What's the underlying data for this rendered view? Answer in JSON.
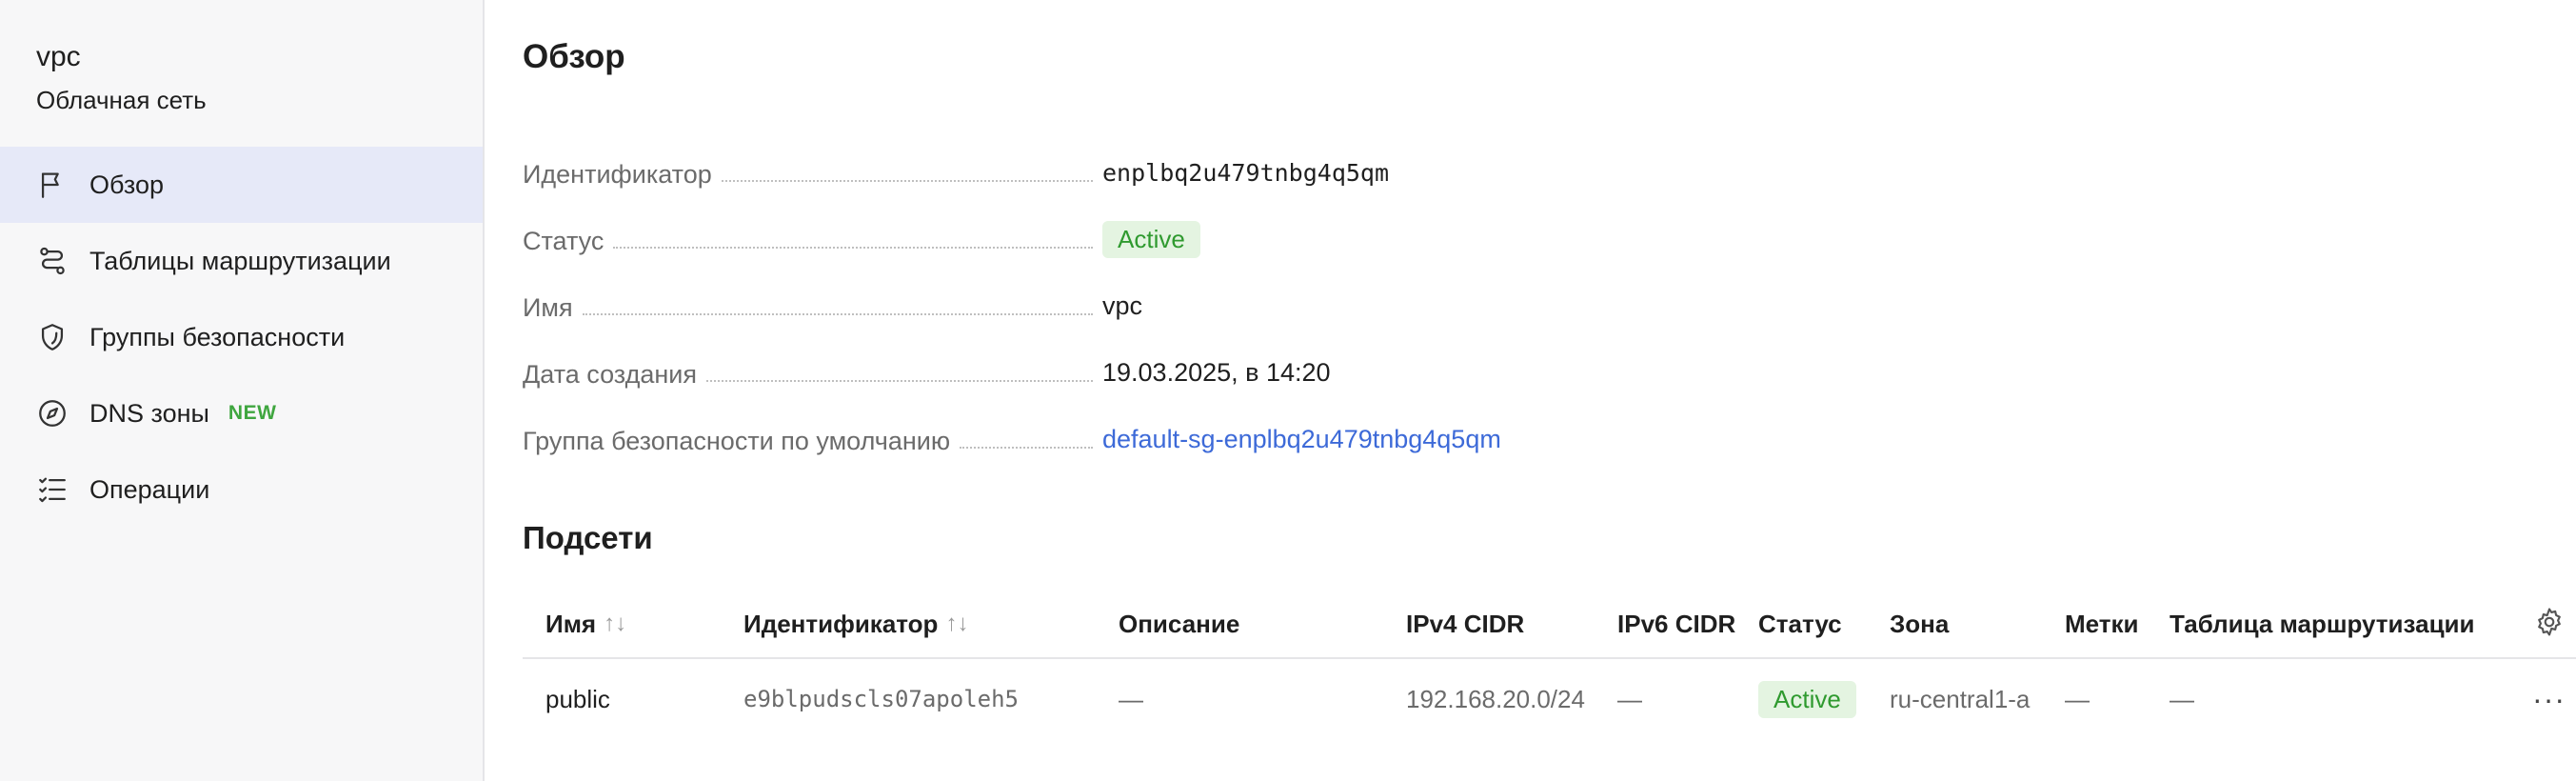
{
  "sidebar": {
    "service_name": "vpc",
    "service_subtitle": "Облачная сеть",
    "items": [
      {
        "label": "Обзор",
        "icon": "flag-icon",
        "active": true
      },
      {
        "label": "Таблицы маршрутизации",
        "icon": "route-icon",
        "active": false
      },
      {
        "label": "Группы безопасности",
        "icon": "shield-icon",
        "active": false
      },
      {
        "label": "DNS зоны",
        "icon": "compass-icon",
        "active": false,
        "badge": "NEW"
      },
      {
        "label": "Операции",
        "icon": "list-check-icon",
        "active": false
      }
    ]
  },
  "overview": {
    "title": "Обзор",
    "props": {
      "id_label": "Идентификатор",
      "id_value": "enplbq2u479tnbg4q5qm",
      "status_label": "Статус",
      "status_value": "Active",
      "name_label": "Имя",
      "name_value": "vpc",
      "created_label": "Дата создания",
      "created_value": "19.03.2025, в 14:20",
      "sg_label": "Группа безопасности по умолчанию",
      "sg_value": "default-sg-enplbq2u479tnbg4q5qm"
    }
  },
  "subnets": {
    "title": "Подсети",
    "columns": [
      "Имя",
      "Идентификатор",
      "Описание",
      "IPv4 CIDR",
      "IPv6 CIDR",
      "Статус",
      "Зона",
      "Метки",
      "Таблица маршрутизации"
    ],
    "sort_glyph": "↑↓",
    "rows": [
      {
        "name": "public",
        "id": "e9blpudscls07apoleh5",
        "description": "—",
        "ipv4": "192.168.20.0/24",
        "ipv6": "—",
        "status": "Active",
        "zone": "ru-central1-a",
        "labels": "—",
        "route_table": "—"
      }
    ],
    "row_menu_glyph": "···"
  },
  "colors": {
    "accent_bg": "#e6e9f8",
    "status_green": "#2f9a2f",
    "status_green_bg": "#e4f4e1",
    "link": "#3d6ad8",
    "new_badge": "#3fa63f"
  }
}
